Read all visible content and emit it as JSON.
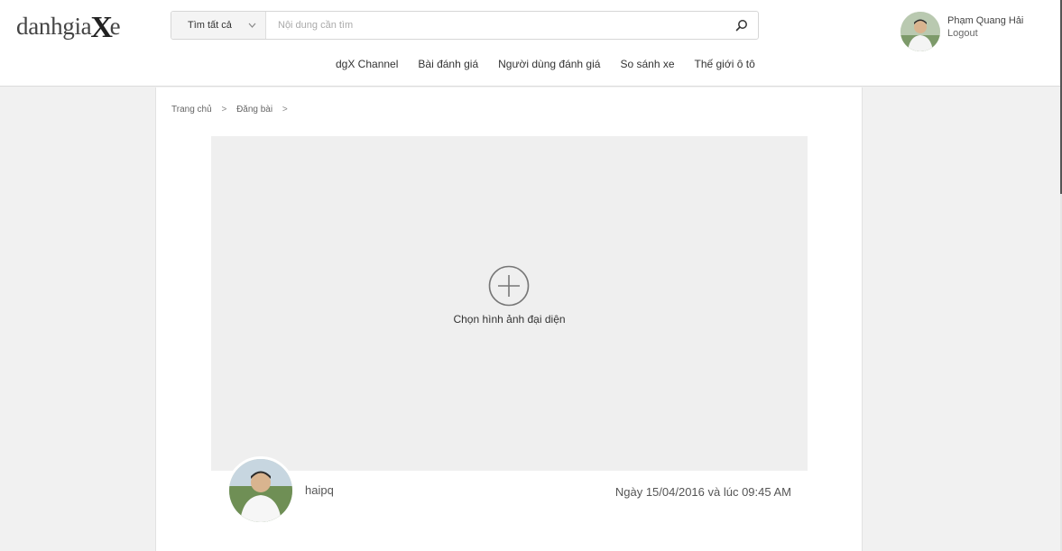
{
  "header": {
    "logo_text_1": "danhgia",
    "logo_text_x": "X",
    "logo_text_2": "e",
    "search": {
      "scope_label": "Tìm tất cả",
      "placeholder": "Nội dung cần tìm",
      "value": ""
    },
    "nav": [
      {
        "label": "dgX Channel"
      },
      {
        "label": "Bài đánh giá"
      },
      {
        "label": "Người dùng đánh giá"
      },
      {
        "label": "So sánh xe"
      },
      {
        "label": "Thế giới ô tô"
      }
    ],
    "user": {
      "name": "Phạm Quang Hải",
      "logout_label": "Logout"
    }
  },
  "breadcrumb": {
    "items": [
      {
        "label": "Trang chủ"
      },
      {
        "label": "Đăng bài"
      }
    ],
    "separator": ">"
  },
  "cover": {
    "label": "Chọn hình ảnh đại diện"
  },
  "post": {
    "author": "haipq",
    "date": "Ngày 15/04/2016 và lúc 09:45 AM"
  },
  "colors": {
    "page_bg": "#f1f1f1",
    "header_bg": "#ffffff",
    "cover_bg": "#efefef",
    "text": "#333333"
  }
}
